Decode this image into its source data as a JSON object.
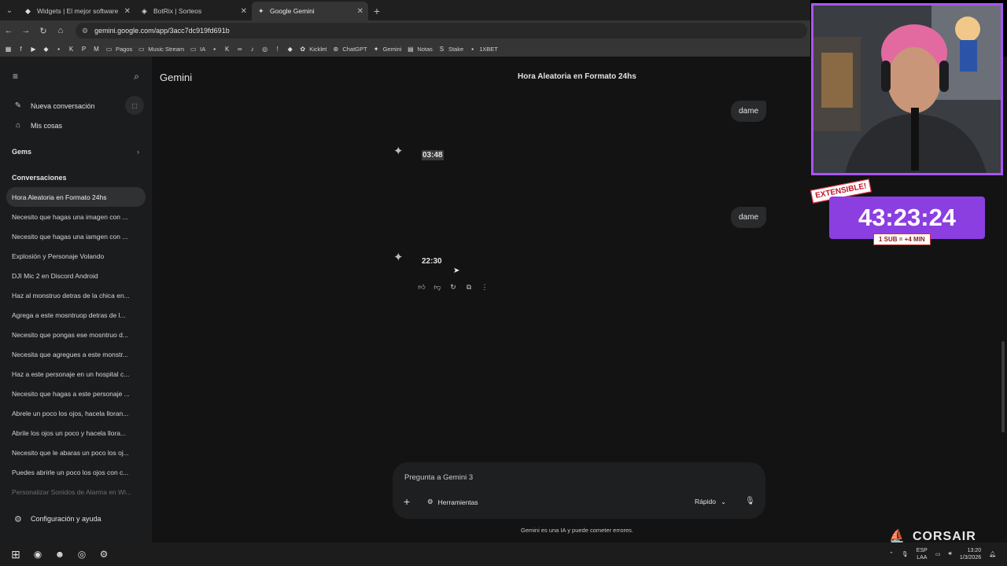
{
  "tabs": [
    {
      "label": "Widgets | El mejor software pa",
      "icon": "widgets-icon",
      "active": false
    },
    {
      "label": "BotRix | Sorteos",
      "icon": "botrix-icon",
      "active": false
    },
    {
      "label": "Google Gemini",
      "icon": "gemini-icon",
      "active": true
    }
  ],
  "address_bar": {
    "url": "gemini.google.com/app/3acc7dc919fd691b"
  },
  "bookmarks": [
    {
      "label": "",
      "icon": "facebook-icon"
    },
    {
      "label": "",
      "icon": "youtube-icon"
    },
    {
      "label": "",
      "icon": "diamond-icon"
    },
    {
      "label": "",
      "icon": "chat-icon"
    },
    {
      "label": "",
      "icon": "kick-icon"
    },
    {
      "label": "",
      "icon": "pinterest-icon"
    },
    {
      "label": "",
      "icon": "gmail-icon"
    },
    {
      "label": "Pagos",
      "icon": "folder-icon"
    },
    {
      "label": "Music Stream",
      "icon": "folder-icon"
    },
    {
      "label": "IA",
      "icon": "folder-icon"
    },
    {
      "label": "",
      "icon": "chat-icon"
    },
    {
      "label": "",
      "icon": "kick-icon"
    },
    {
      "label": "",
      "icon": "loop-icon"
    },
    {
      "label": "",
      "icon": "tiktok-icon"
    },
    {
      "label": "",
      "icon": "instagram-icon"
    },
    {
      "label": "",
      "icon": "exclamation-icon"
    },
    {
      "label": "",
      "icon": "diamond-icon"
    },
    {
      "label": "Kicklet",
      "icon": "kicklet-icon"
    },
    {
      "label": "ChatGPT",
      "icon": "chatgpt-icon"
    },
    {
      "label": "Gemini",
      "icon": "gemini-icon"
    },
    {
      "label": "Notas",
      "icon": "notes-icon"
    },
    {
      "label": "Stake",
      "icon": "stake-icon"
    },
    {
      "label": "1XBET",
      "icon": "1xbet-icon"
    }
  ],
  "sidebar": {
    "new_chat": "Nueva conversación",
    "my_stuff": "Mis cosas",
    "gems": "Gems",
    "conversations_header": "Conversaciones",
    "conversations": [
      "Hora Aleatoria en Formato 24hs",
      "Necesito que hagas una imagen con ...",
      "Necesito que hagas una iamgen con ...",
      "Explosión y Personaje Volando",
      "DJI Mic 2 en Discord Android",
      "Haz al monstruo detras de la chica en...",
      "Agrega a este mosntruop detras de l...",
      "Necesito que pongas ese mosntruo d...",
      "Necesita que agregues a este monstr...",
      "Haz a este personaje en un hospital c...",
      "Necesito que hagas a este personaje ...",
      "Abrele un poco los ojos, hacela lloran...",
      "Abrile los ojos un poco y hacela llora...",
      "Necesito que le abaras un poco los oj...",
      "Puedes abrirle un poco los ojos con c...",
      "Personalizar Sonidos de Alarma en Wi..."
    ],
    "settings": "Configuración y ayuda"
  },
  "main": {
    "brand": "Gemini",
    "conversation_title": "Hora Aleatoria en Formato 24hs",
    "messages": [
      {
        "role": "user",
        "text": "dame"
      },
      {
        "role": "model",
        "text": "03:48"
      },
      {
        "role": "user",
        "text": "dame"
      },
      {
        "role": "model",
        "text": "22:30"
      }
    ],
    "composer": {
      "placeholder": "Pregunta a Gemini 3",
      "tools": "Herramientas",
      "mode": "Rápido"
    },
    "disclaimer": "Gemini es una IA y puede cometer errores."
  },
  "taskbar": {
    "lang_top": "ESP",
    "lang_bottom": "LAA",
    "time": "13:20",
    "date": "1/3/2026"
  },
  "overlay": {
    "timer": "43:23:24",
    "badge": "EXTENSIBLE!",
    "sub_rule": "1 SUB = +4 MIN",
    "brand": "CORSAIR"
  },
  "colors": {
    "accent": "#a855f7",
    "timer_bg": "#8b3fe0",
    "sidebar_bg": "#1b1c1d",
    "main_bg": "#131314"
  }
}
